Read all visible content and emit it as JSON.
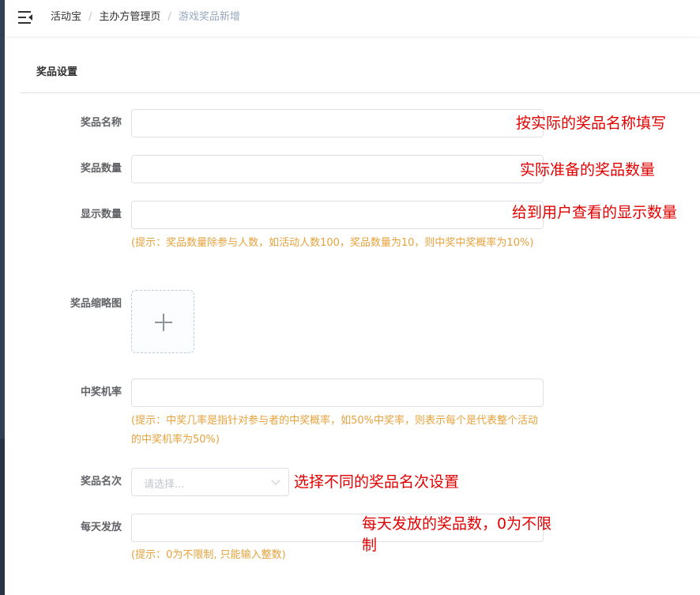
{
  "breadcrumb": {
    "items": [
      "活动宝",
      "主办方管理页",
      "游戏奖品新增"
    ],
    "separator": "/"
  },
  "card": {
    "title": "奖品设置"
  },
  "form": {
    "prize_name": {
      "label": "奖品名称",
      "value": ""
    },
    "prize_count": {
      "label": "奖品数量",
      "value": ""
    },
    "display_count": {
      "label": "显示数量",
      "value": "",
      "hint": "(提示：奖品数量除参与人数，如活动人数100，奖品数量为10，则中奖中奖概率为10%)"
    },
    "thumbnail": {
      "label": "奖品缩略图",
      "icon": "plus-icon"
    },
    "win_rate": {
      "label": "中奖机率",
      "value": "",
      "hint": "(提示：中奖几率是指针对参与者的中奖概率，如50%中奖率，则表示每个是代表整个活动的中奖机率为50%)"
    },
    "prize_rank": {
      "label": "奖品名次",
      "placeholder": "请选择...",
      "icon": "chevron-down-icon"
    },
    "daily_release": {
      "label": "每天发放",
      "value": "",
      "hint": "(提示：0为不限制, 只能输入整数)"
    }
  },
  "annotations": {
    "prize_name": "按实际的奖品名称填写",
    "prize_count": "实际准备的奖品数量",
    "display_count": "给到用户查看的显示数量",
    "prize_rank": "选择不同的奖品名次设置",
    "daily_release": "每天发放的奖品数，0为不限制"
  },
  "colors": {
    "hint": "#e6a23c",
    "annotation": "#e30000",
    "sidebar": "#304156"
  }
}
